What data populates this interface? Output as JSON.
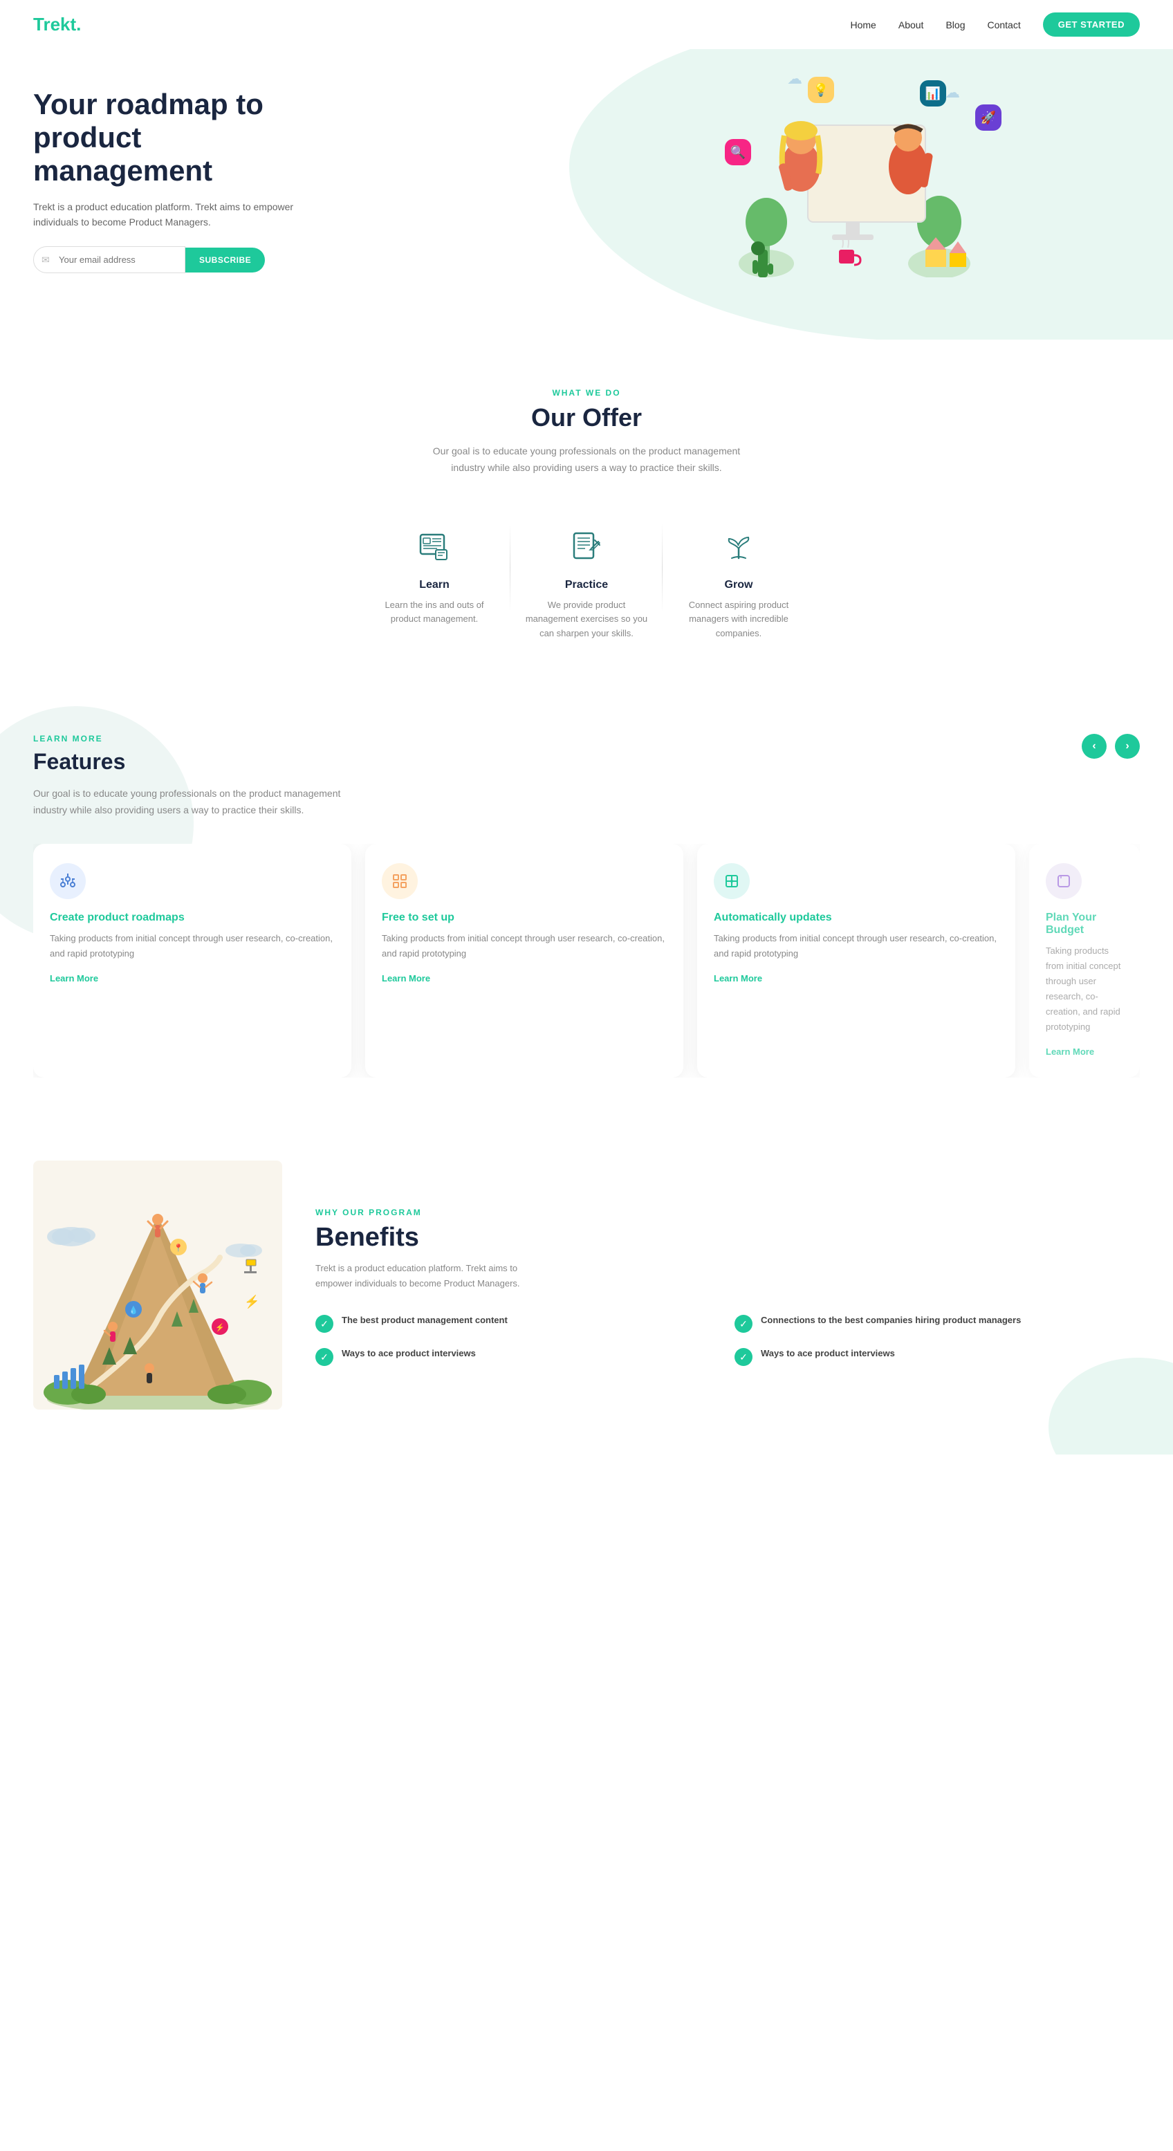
{
  "nav": {
    "logo": "Trekt.",
    "links": [
      {
        "label": "Home",
        "href": "#"
      },
      {
        "label": "About",
        "href": "#"
      },
      {
        "label": "Blog",
        "href": "#"
      },
      {
        "label": "Contact",
        "href": "#"
      }
    ],
    "cta": "GET STARTED"
  },
  "hero": {
    "title": "Your roadmap to product management",
    "subtitle": "Trekt is a product education platform. Trekt aims to empower individuals to become Product Managers.",
    "email_placeholder": "Your email address",
    "subscribe_label": "SUBSCRIBE"
  },
  "offer": {
    "section_label": "WHAT WE DO",
    "title": "Our Offer",
    "subtitle": "Our goal is to educate young professionals on the product management industry while also providing users a way to practice their skills.",
    "cards": [
      {
        "name": "Learn",
        "description": "Learn the ins and outs of product management."
      },
      {
        "name": "Practice",
        "description": "We provide product management exercises so you can sharpen your skills."
      },
      {
        "name": "Grow",
        "description": "Connect aspiring product managers with incredible companies."
      }
    ]
  },
  "features": {
    "section_label": "LEARN MORE",
    "title": "Features",
    "subtitle": "Our goal is to educate young professionals on the product management industry while also providing users a way to practice their skills.",
    "cards": [
      {
        "title": "Create product roadmaps",
        "description": "Taking products from initial concept through user research, co-creation, and rapid prototyping",
        "link": "Learn More",
        "icon_type": "fi-blue"
      },
      {
        "title": "Free to set up",
        "description": "Taking products from initial concept through user research, co-creation, and rapid prototyping",
        "link": "Learn More",
        "icon_type": "fi-orange"
      },
      {
        "title": "Automatically updates",
        "description": "Taking products from initial concept through user research, co-creation, and rapid prototyping",
        "link": "Learn More",
        "icon_type": "fi-teal2"
      },
      {
        "title": "Plan Your Budget",
        "description": "Taking products from initial concept through user research, co-creation, and rapid prototyping",
        "link": "Learn More",
        "icon_type": "fi-lavender"
      }
    ]
  },
  "benefits": {
    "section_label": "WHY OUR PROGRAM",
    "title": "Benefits",
    "subtitle": "Trekt is a product education platform. Trekt aims to empower individuals to become Product Managers.",
    "items": [
      {
        "text": "The best product management content"
      },
      {
        "text": "Connections to the best companies hiring product managers"
      },
      {
        "text": "Ways to ace product interviews"
      },
      {
        "text": "Ways to ace product interviews"
      }
    ]
  }
}
